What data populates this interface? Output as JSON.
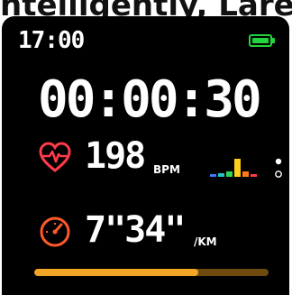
{
  "header_caption": "ntelligently, Lare",
  "status": {
    "time": "17:00",
    "battery_icon": "battery-full-icon",
    "battery_color": "#23d43c"
  },
  "workout": {
    "elapsed": "00:00:30",
    "heart_rate": {
      "icon": "heart-pulse-icon",
      "value": "198",
      "unit": "BPM",
      "color": "#ff3b4a",
      "zone_bars": [
        {
          "level": 0.15,
          "color": "#3a7bff"
        },
        {
          "level": 0.2,
          "color": "#27c2c8"
        },
        {
          "level": 0.3,
          "color": "#31d25a"
        },
        {
          "level": 1.0,
          "color": "#ffcc1f"
        },
        {
          "level": 0.3,
          "color": "#ff7a1a"
        },
        {
          "level": 0.15,
          "color": "#ff3b4a"
        }
      ]
    },
    "pace": {
      "icon": "speedometer-icon",
      "value": "7\"34\"",
      "unit": "/KM",
      "color": "#ff5a2a"
    },
    "progress": 0.7,
    "progress_color": "#f0a524"
  },
  "pager": {
    "count": 2,
    "active": 0
  }
}
